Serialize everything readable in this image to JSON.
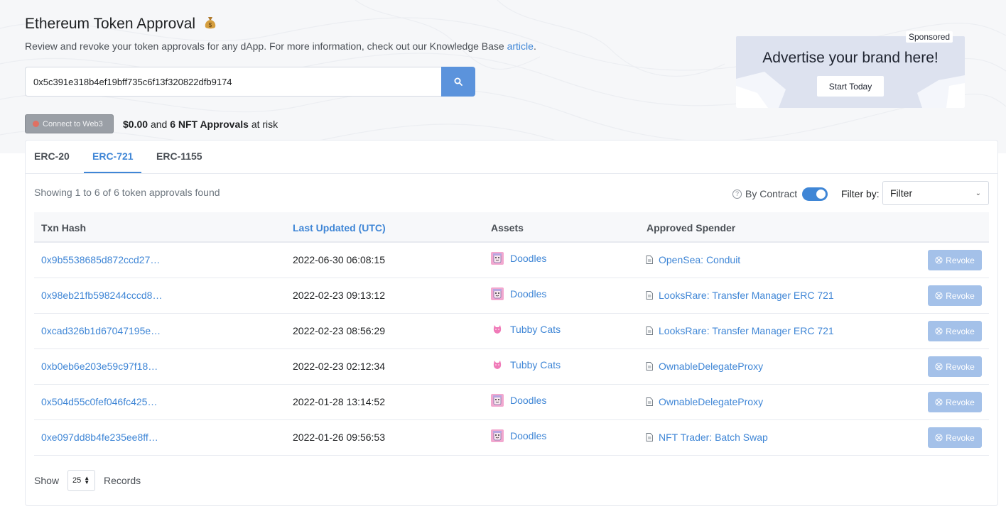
{
  "header": {
    "title": "Ethereum Token Approval",
    "subtitle_text": "Review and revoke your token approvals for any dApp. For more information, check out our Knowledge Base",
    "subtitle_link": "article",
    "subtitle_end": "."
  },
  "search": {
    "value": "0x5c391e318b4ef19bff735c6f13f320822dfb9174"
  },
  "web3": {
    "connect_label": "Connect to Web3",
    "risk_value": "$0.00",
    "risk_and": "and",
    "risk_nft": "6 NFT Approvals",
    "risk_suffix": "at risk"
  },
  "ad": {
    "sponsored": "Sponsored",
    "headline": "Advertise your brand here!",
    "cta": "Start Today"
  },
  "tabs": [
    {
      "label": "ERC-20"
    },
    {
      "label": "ERC-721"
    },
    {
      "label": "ERC-1155"
    }
  ],
  "toolbar": {
    "showing": "Showing 1 to 6 of 6 token approvals found",
    "by_contract": "By Contract",
    "filter_by": "Filter by:",
    "filter_value": "Filter"
  },
  "table": {
    "columns": [
      "Txn Hash",
      "Last Updated (UTC)",
      "Assets",
      "Approved Spender"
    ],
    "revoke_label": "Revoke",
    "rows": [
      {
        "hash": "0x9b5538685d872ccd27…",
        "date": "2022-06-30 06:08:15",
        "asset": "Doodles",
        "asset_icon": "doodles-icon",
        "spender": "OpenSea: Conduit"
      },
      {
        "hash": "0x98eb21fb598244cccd8…",
        "date": "2022-02-23 09:13:12",
        "asset": "Doodles",
        "asset_icon": "doodles-icon",
        "spender": "LooksRare: Transfer Manager ERC 721"
      },
      {
        "hash": "0xcad326b1d67047195e…",
        "date": "2022-02-23 08:56:29",
        "asset": "Tubby Cats",
        "asset_icon": "tubby-cats-icon",
        "spender": "LooksRare: Transfer Manager ERC 721"
      },
      {
        "hash": "0xb0eb6e203e59c97f18…",
        "date": "2022-02-23 02:12:34",
        "asset": "Tubby Cats",
        "asset_icon": "tubby-cats-icon",
        "spender": "OwnableDelegateProxy"
      },
      {
        "hash": "0x504d55c0fef046fc425…",
        "date": "2022-01-28 13:14:52",
        "asset": "Doodles",
        "asset_icon": "doodles-icon",
        "spender": "OwnableDelegateProxy"
      },
      {
        "hash": "0xe097dd8b4fe235ee8ff…",
        "date": "2022-01-26 09:56:53",
        "asset": "Doodles",
        "asset_icon": "doodles-icon",
        "spender": "NFT Trader: Batch Swap"
      }
    ]
  },
  "footer": {
    "show": "Show",
    "records_value": "25",
    "records": "Records"
  },
  "colors": {
    "accent": "#3f86d6",
    "revoke_disabled": "#a4c1e9",
    "hero_bg": "#f6f7f9"
  }
}
